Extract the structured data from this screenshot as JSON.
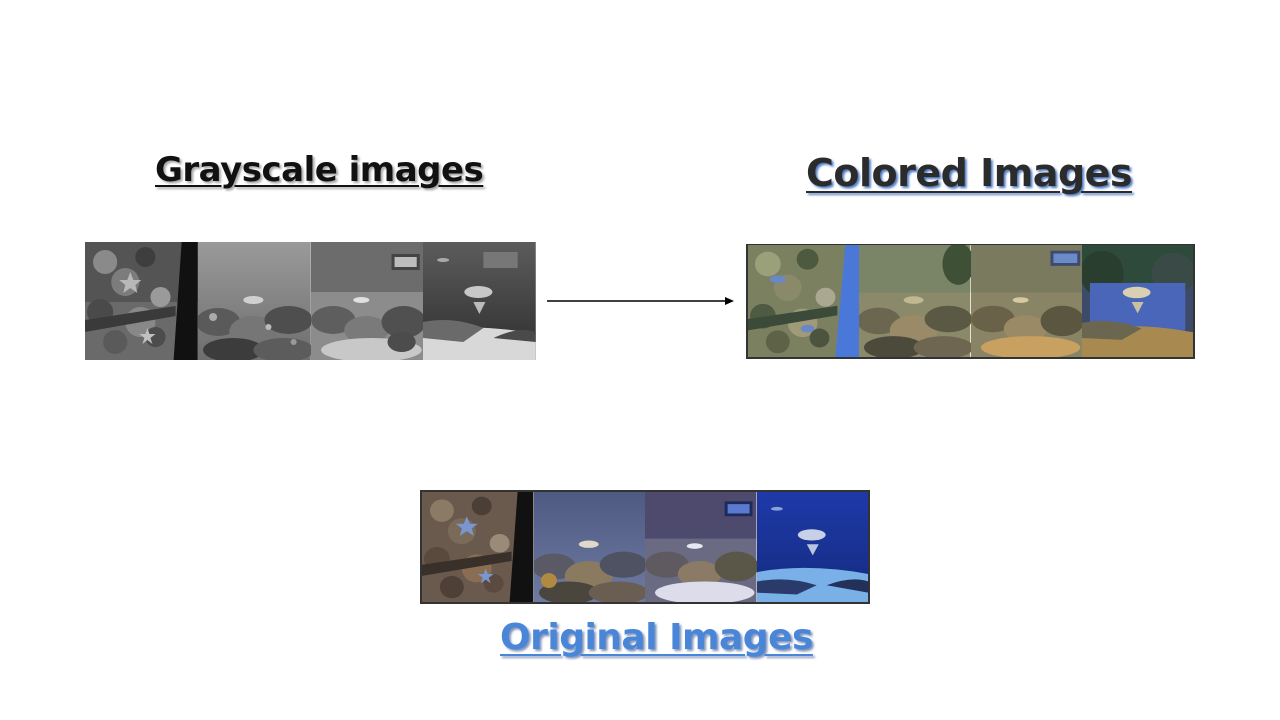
{
  "headings": {
    "grayscale": "Grayscale images",
    "colored": "Colored Images",
    "original": "Original Images"
  },
  "colors": {
    "original_label": "#4a86d8",
    "colored_shadow": "#3c6ebe"
  },
  "strips": {
    "grayscale": {
      "tile_count": 4,
      "tiles": [
        "starfish-rock-scene",
        "coral-reef-scene",
        "coral-reef-fish-scene",
        "stingray-scene"
      ]
    },
    "colored": {
      "tile_count": 4,
      "tiles": [
        "starfish-rock-scene",
        "coral-reef-scene",
        "coral-reef-fish-scene",
        "stingray-scene"
      ]
    },
    "original": {
      "tile_count": 4,
      "tiles": [
        "starfish-rock-scene",
        "coral-reef-scene",
        "coral-reef-fish-scene",
        "stingray-scene"
      ]
    }
  }
}
